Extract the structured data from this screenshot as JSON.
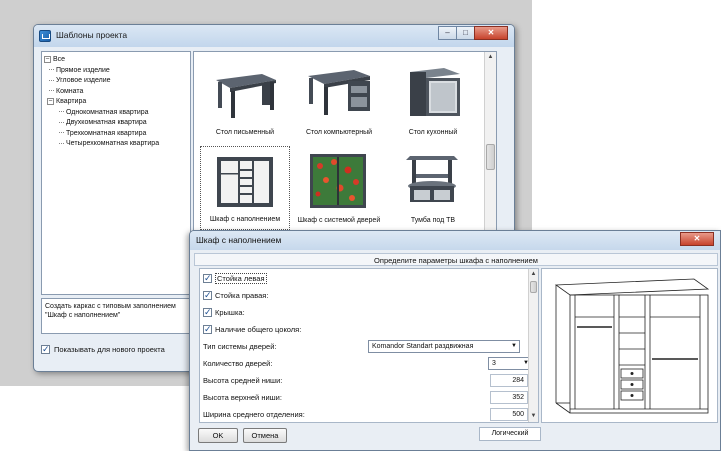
{
  "templates_window": {
    "title": "Шаблоны проекта",
    "controls": {
      "minimize": "–",
      "maximize": "□",
      "close": "✕"
    },
    "tree": [
      {
        "label": "Все",
        "level": 0,
        "expander": "–"
      },
      {
        "label": "Прямое изделие",
        "level": 1
      },
      {
        "label": "Угловое изделие",
        "level": 1
      },
      {
        "label": "Комната",
        "level": 1
      },
      {
        "label": "Квартира",
        "level": 1,
        "expander": "–"
      },
      {
        "label": "Однокомнатная квартира",
        "level": 2
      },
      {
        "label": "Двухкомнатная квартира",
        "level": 2
      },
      {
        "label": "Трехкомнатная квартира",
        "level": 2
      },
      {
        "label": "Четырехкомнатная квартира",
        "level": 2
      }
    ],
    "templates": [
      {
        "label": "Стол письменный",
        "icon": "desk-icon"
      },
      {
        "label": "Стол компьютерный",
        "icon": "computer-desk-icon"
      },
      {
        "label": "Стол кухонный",
        "icon": "kitchen-table-icon"
      },
      {
        "label": "Шкаф с наполнением",
        "icon": "wardrobe-icon",
        "selected": true
      },
      {
        "label": "Шкаф с системой дверей",
        "icon": "sliding-door-wardrobe-icon"
      },
      {
        "label": "Тумба под ТВ",
        "icon": "tv-stand-icon"
      }
    ],
    "description": "Создать каркас с типовым заполнением \"Шкаф с наполнением\"",
    "show_for_new_project": {
      "label": "Показывать для нового проекта",
      "checked": true
    }
  },
  "wardrobe_window": {
    "title": "Шкаф с наполнением",
    "close": "✕",
    "header": "Определите параметры шкафа с наполнением",
    "checkboxes": [
      {
        "label": "Стойка левая",
        "checked": true
      },
      {
        "label": "Стойка правая:",
        "checked": true
      },
      {
        "label": "Крышка:",
        "checked": true
      },
      {
        "label": "Наличие общего цоколя:",
        "checked": true
      }
    ],
    "door_system": {
      "label": "Тип системы дверей:",
      "value": "Komandor Standart раздвижная"
    },
    "door_count": {
      "label": "Количество дверей:",
      "value": "3"
    },
    "middle_niche_height": {
      "label": "Высота средней ниши:",
      "value": "284"
    },
    "top_niche_height": {
      "label": "Высота верхней ниши:",
      "value": "352"
    },
    "middle_section_width": {
      "label": "Ширина среднего отделения:",
      "value": "500"
    },
    "ok_label": "OK",
    "cancel_label": "Отмена",
    "status": "Логический"
  }
}
